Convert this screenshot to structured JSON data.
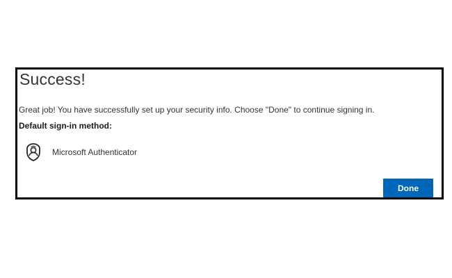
{
  "dialog": {
    "title": "Success!",
    "message": "Great job! You have successfully set up your security info. Choose \"Done\" to continue signing in.",
    "method_heading": "Default sign-in method:",
    "method": {
      "icon": "authenticator-icon",
      "label": "Microsoft Authenticator"
    },
    "done_label": "Done"
  },
  "colors": {
    "primary_button": "#0067b8",
    "border": "#000000"
  }
}
